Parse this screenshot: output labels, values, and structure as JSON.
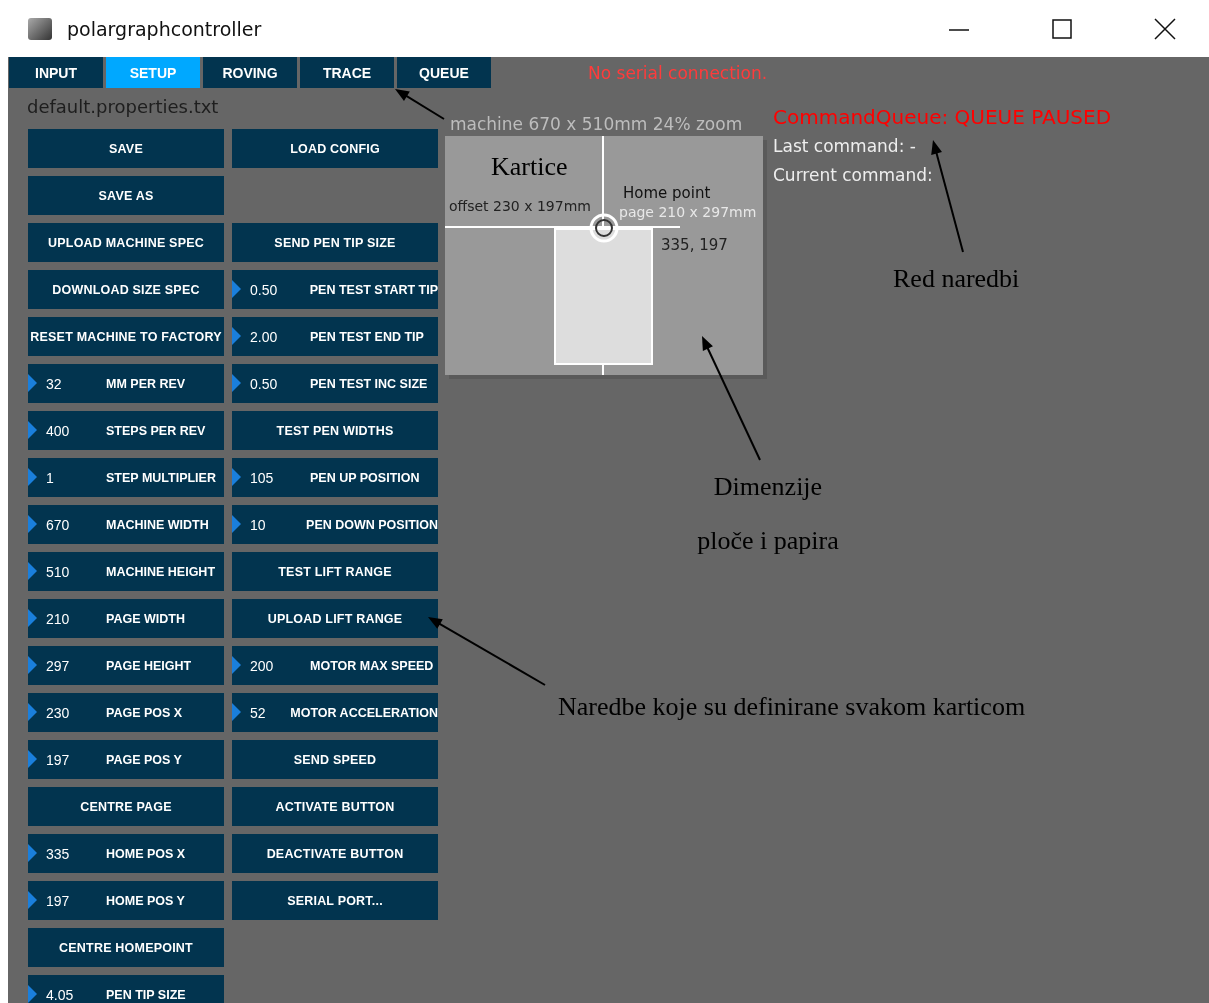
{
  "window": {
    "title": "polargraphcontroller"
  },
  "tabs": [
    {
      "label": "INPUT",
      "selected": false
    },
    {
      "label": "SETUP",
      "selected": true
    },
    {
      "label": "ROVING",
      "selected": false
    },
    {
      "label": "TRACE",
      "selected": false
    },
    {
      "label": "QUEUE",
      "selected": false
    }
  ],
  "serial_status": "No serial connection.",
  "file_name": "default.properties.txt",
  "control_rows": [
    {
      "left": {
        "kind": "button",
        "label": "SAVE"
      },
      "right": {
        "kind": "button",
        "label": "LOAD CONFIG"
      }
    },
    {
      "left": {
        "kind": "button",
        "label": "SAVE AS"
      }
    },
    {
      "left": {
        "kind": "button",
        "label": "UPLOAD MACHINE SPEC"
      },
      "right": {
        "kind": "button",
        "label": "SEND PEN TIP SIZE"
      }
    },
    {
      "left": {
        "kind": "button",
        "label": "DOWNLOAD SIZE SPEC"
      },
      "right": {
        "kind": "number",
        "value": "0.50",
        "label": "PEN TEST START TIP"
      }
    },
    {
      "left": {
        "kind": "button",
        "label": "RESET MACHINE TO FACTORY"
      },
      "right": {
        "kind": "number",
        "value": "2.00",
        "label": "PEN TEST END TIP"
      }
    },
    {
      "left": {
        "kind": "number",
        "value": "32",
        "label": "MM PER REV"
      },
      "right": {
        "kind": "number",
        "value": "0.50",
        "label": "PEN TEST INC SIZE"
      }
    },
    {
      "left": {
        "kind": "number",
        "value": "400",
        "label": "STEPS PER REV"
      },
      "right": {
        "kind": "button",
        "label": "TEST PEN WIDTHS"
      }
    },
    {
      "left": {
        "kind": "number",
        "value": "1",
        "label": "STEP MULTIPLIER"
      },
      "right": {
        "kind": "number",
        "value": "105",
        "label": "PEN UP POSITION"
      }
    },
    {
      "left": {
        "kind": "number",
        "value": "670",
        "label": "MACHINE WIDTH"
      },
      "right": {
        "kind": "number",
        "value": "10",
        "label": "PEN DOWN POSITION"
      }
    },
    {
      "left": {
        "kind": "number",
        "value": "510",
        "label": "MACHINE HEIGHT"
      },
      "right": {
        "kind": "button",
        "label": "TEST LIFT RANGE"
      }
    },
    {
      "left": {
        "kind": "number",
        "value": "210",
        "label": "PAGE WIDTH"
      },
      "right": {
        "kind": "button",
        "label": "UPLOAD LIFT RANGE"
      }
    },
    {
      "left": {
        "kind": "number",
        "value": "297",
        "label": "PAGE HEIGHT"
      },
      "right": {
        "kind": "number",
        "value": "200",
        "label": "MOTOR MAX SPEED"
      }
    },
    {
      "left": {
        "kind": "number",
        "value": "230",
        "label": "PAGE POS X"
      },
      "right": {
        "kind": "number",
        "value": "52",
        "label": "MOTOR ACCELERATION"
      }
    },
    {
      "left": {
        "kind": "number",
        "value": "197",
        "label": "PAGE POS Y"
      },
      "right": {
        "kind": "button",
        "label": "SEND SPEED"
      }
    },
    {
      "left": {
        "kind": "button",
        "label": "CENTRE PAGE"
      },
      "right": {
        "kind": "button",
        "label": "ACTIVATE BUTTON"
      }
    },
    {
      "left": {
        "kind": "number",
        "value": "335",
        "label": "HOME POS X"
      },
      "right": {
        "kind": "button",
        "label": "DEACTIVATE BUTTON"
      }
    },
    {
      "left": {
        "kind": "number",
        "value": "197",
        "label": "HOME POS Y"
      },
      "right": {
        "kind": "button",
        "label": "SERIAL PORT..."
      }
    },
    {
      "left": {
        "kind": "button",
        "label": "CENTRE HOMEPOINT"
      }
    },
    {
      "left": {
        "kind": "number",
        "value": "4.05",
        "label": "PEN TIP SIZE"
      }
    }
  ],
  "machine_preview": {
    "caption": "machine 670 x 510mm 24% zoom",
    "page_label": "page 210 x 297mm",
    "home_label": "Home point",
    "offset_label": "offset 230 x 197mm",
    "home_coords": "335, 197"
  },
  "command_queue": {
    "status": "CommandQueue: QUEUE PAUSED",
    "last_command": "Last command: -",
    "current_command": "Current command:"
  },
  "annotations": [
    {
      "kind": "tabs",
      "text": "Kartice"
    },
    {
      "kind": "queue",
      "text": "Red naredbi"
    },
    {
      "kind": "preview",
      "text": "Dimenzije ploče i papira"
    },
    {
      "kind": "controls",
      "text": "Naredbe koje su definirane svakom karticom"
    }
  ]
}
